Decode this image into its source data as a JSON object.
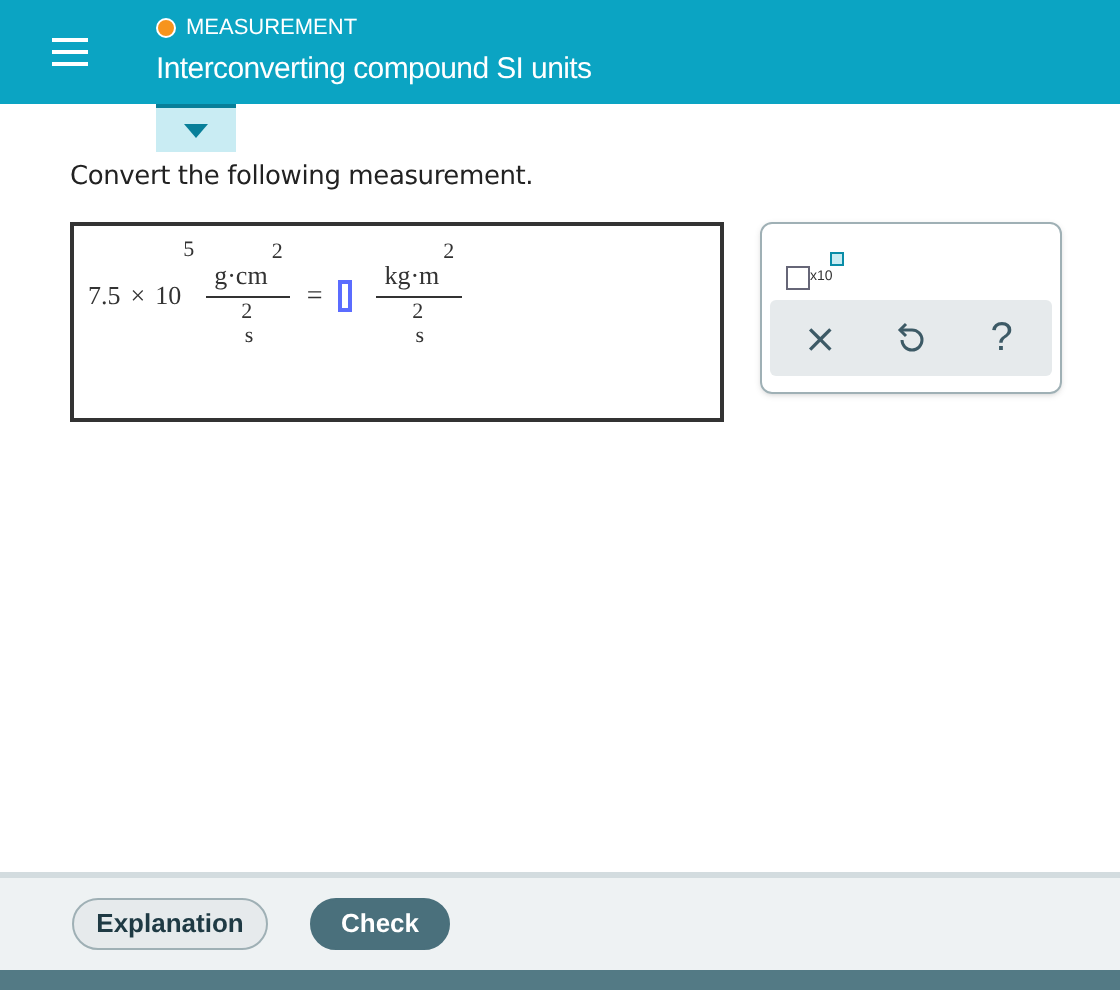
{
  "header": {
    "topic": "MEASUREMENT",
    "title": "Interconverting compound SI units"
  },
  "prompt": "Convert the following measurement.",
  "equation": {
    "coefficient": "7.5",
    "times": "×",
    "base": "10",
    "exponent": "5",
    "given_unit": {
      "numerator": "g·cm",
      "numerator_exponent": "2",
      "denominator": "s",
      "denominator_exponent": "2"
    },
    "equals": "=",
    "target_unit": {
      "numerator": "kg·m",
      "numerator_exponent": "2",
      "denominator": "s",
      "denominator_exponent": "2"
    }
  },
  "tools": {
    "template_label": "x10",
    "clear": "×",
    "help": "?"
  },
  "footer": {
    "buttons": [
      {
        "label": "Explanation",
        "kind": "secondary"
      },
      {
        "label": "Check",
        "kind": "primary"
      }
    ]
  }
}
